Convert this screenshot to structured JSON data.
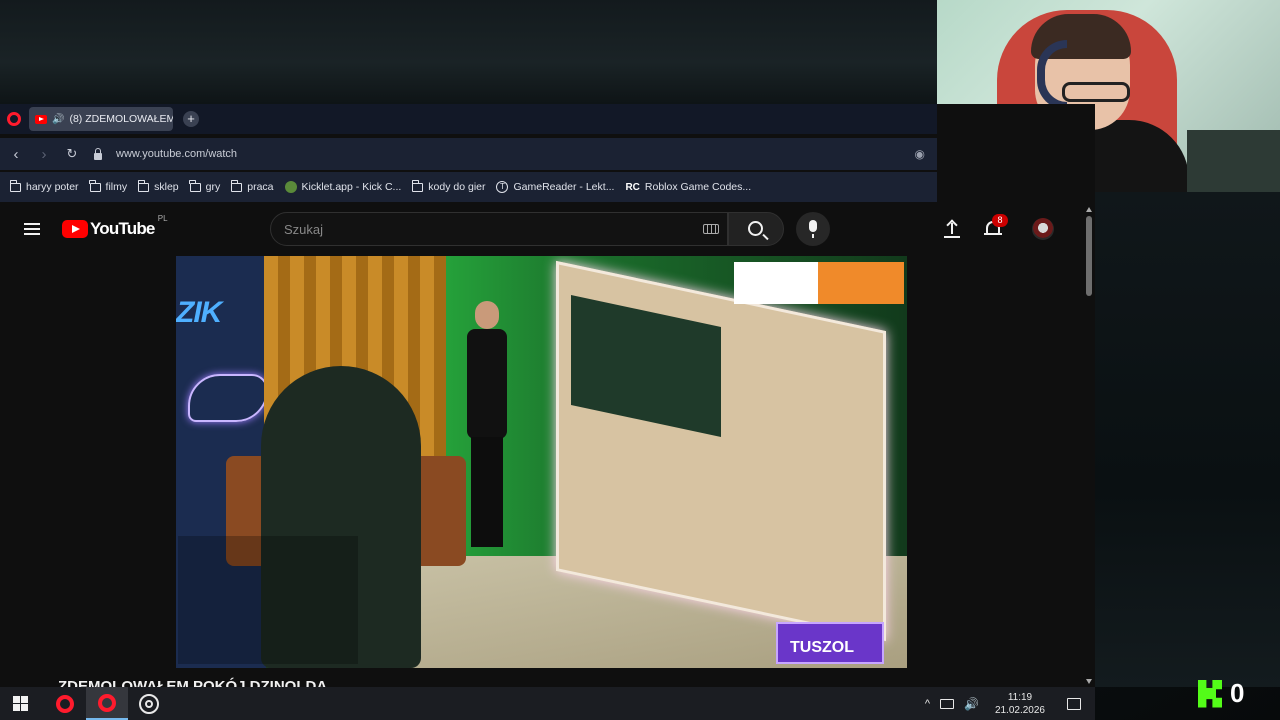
{
  "browser": {
    "tab_title": "(8) ZDEMOLOWAŁEM",
    "url": "www.youtube.com/watch",
    "bookmarks": [
      {
        "label": "haryy poter",
        "icon": "folder-icon"
      },
      {
        "label": "filmy",
        "icon": "folder-icon"
      },
      {
        "label": "sklep",
        "icon": "folder-icon"
      },
      {
        "label": "gry",
        "icon": "folder-icon"
      },
      {
        "label": "praca",
        "icon": "folder-icon"
      },
      {
        "label": "Kicklet.app - Kick C...",
        "icon": "kicklet-icon"
      },
      {
        "label": "kody do gier",
        "icon": "folder-icon"
      },
      {
        "label": "GameReader - Lekt...",
        "icon": "gamereader-icon"
      },
      {
        "label": "Roblox Game Codes...",
        "icon": "rc-icon"
      }
    ]
  },
  "youtube": {
    "logo_text": "YouTube",
    "region": "PL",
    "search_placeholder": "Szukaj",
    "notification_count": "8",
    "video_title": "ZDEMOLOWAŁEM POKÓJ DZINOLDA",
    "video_overlay": {
      "brand": "ZIK",
      "promo": "TUSZOL"
    }
  },
  "taskbar": {
    "time": "11:19",
    "date": "21.02.2026"
  },
  "kick": {
    "count": "0"
  },
  "colors": {
    "youtube_red": "#ff0000",
    "opera_red": "#ff1b2d",
    "kick_green": "#53fc18",
    "badge_red": "#cc0000"
  }
}
